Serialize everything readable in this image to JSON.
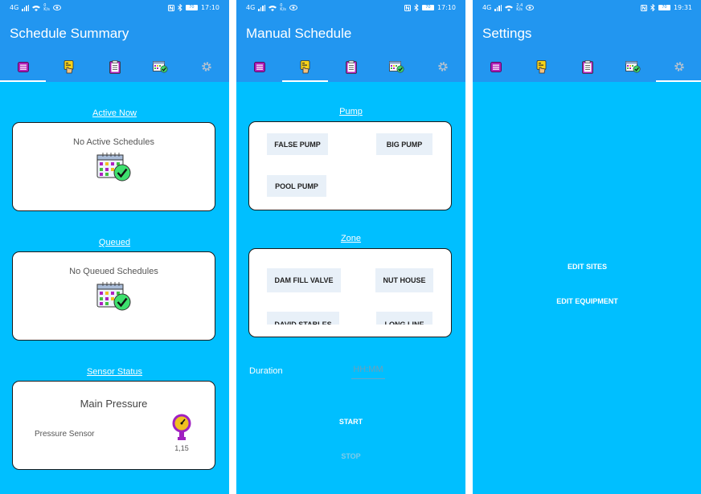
{
  "status_bars": [
    {
      "network": "4G",
      "speed": "0\nK/s",
      "time": "17:10",
      "battery": "70"
    },
    {
      "network": "4G",
      "speed": "0\nK/s",
      "time": "17:10",
      "battery": "70"
    },
    {
      "network": "4G",
      "speed": "2,4\nK/s",
      "time": "19:31",
      "battery": "70"
    }
  ],
  "screens": {
    "summary": {
      "title": "Schedule Summary",
      "active_title": "Active Now",
      "active_text": "No Active Schedules",
      "queued_title": "Queued",
      "queued_text": "No Queued Schedules",
      "sensor_title": "Sensor Status",
      "sensor_heading": "Main Pressure",
      "sensor_label": "Pressure Sensor",
      "sensor_value": "1,15"
    },
    "manual": {
      "title": "Manual Schedule",
      "pump_title": "Pump",
      "pumps": [
        "FALSE PUMP",
        "BIG PUMP",
        "POOL PUMP"
      ],
      "zone_title": "Zone",
      "zones": [
        "DAM FILL VALVE",
        "NUT HOUSE",
        "DAVID STABLES",
        "LONG LINE"
      ],
      "duration_label": "Duration",
      "duration_placeholder": "HH:MM",
      "start_label": "START",
      "stop_label": "STOP"
    },
    "settings": {
      "title": "Settings",
      "edit_sites": "EDIT SITES",
      "edit_equipment": "EDIT EQUIPMENT"
    }
  },
  "tabs": [
    {
      "icon": "list-icon"
    },
    {
      "icon": "hand-schedule-icon"
    },
    {
      "icon": "clipboard-icon"
    },
    {
      "icon": "calendar-check-icon"
    },
    {
      "icon": "gear-icon"
    }
  ],
  "colors": {
    "appbar": "#2296f0",
    "background": "#00bfff",
    "card": "#ffffff"
  }
}
